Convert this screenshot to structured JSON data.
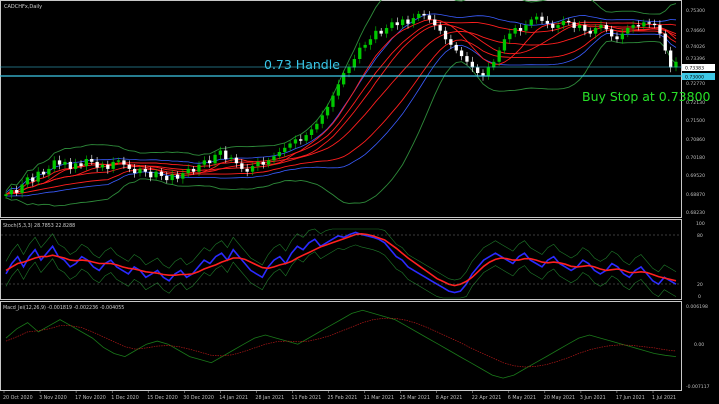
{
  "symbol_label": "CADCHFx,Daily",
  "colors": {
    "background": "#000000",
    "panel_border": "#c8c8c8",
    "bull_candle": "#00c800",
    "bear_candle": "#ffffff",
    "ma_lines": "#ff1e1e",
    "bb_outer": "#2e8b3a",
    "bb_mid": "#3a5cff",
    "handle_line": "#3ec8e6",
    "stoch_main": "#2a2aff",
    "stoch_signal": "#ff2020",
    "stoch_range": "#1f7a2a",
    "macd_main": "#1a7a1a",
    "macd_signal": "#b01818",
    "axis_text": "#bfbfbf",
    "annotation_handle": "#39c6e8",
    "annotation_buy": "#28e028"
  },
  "main_panel": {
    "price_ticks": [
      "0.75300",
      "0.74660",
      "0.74026",
      "0.73396",
      "0.72770",
      "0.72130",
      "0.71500",
      "0.70860",
      "0.70180",
      "0.69520",
      "0.68870",
      "0.68230"
    ],
    "price_tag_1": "0.73383",
    "price_tag_2": "0.73000",
    "annotation_handle": "0.73 Handle",
    "annotation_buy": "Buy Stop at 0.73800"
  },
  "stoch_panel": {
    "label": "Stoch(5,3,3) 28.7853 22.8288",
    "ticks": [
      "100",
      "80",
      "20",
      "0"
    ]
  },
  "macd_panel": {
    "label": "Macd_Jei(12,26,9) -0.001819 -0.002236 -0.004055",
    "ticks": [
      "0.006198",
      "0.00",
      "-0.007117"
    ]
  },
  "date_labels": [
    "20 Oct 2020",
    "3 Nov 2020",
    "17 Nov 2020",
    "1 Dec 2020",
    "15 Dec 2020",
    "30 Dec 2020",
    "14 Jan 2021",
    "28 Jan 2021",
    "11 Feb 2021",
    "25 Feb 2021",
    "11 Mar 2021",
    "25 Mar 2021",
    "8 Apr 2021",
    "22 Apr 2021",
    "6 May 2021",
    "20 May 2021",
    "3 Jun 2021",
    "17 Jun 2021",
    "1 Jul 2021"
  ],
  "chart_data": {
    "type": "candlestick",
    "symbol": "CADCHFx",
    "timeframe": "Daily",
    "closes": [
      0.687,
      0.6885,
      0.6875,
      0.6905,
      0.693,
      0.6915,
      0.695,
      0.694,
      0.696,
      0.699,
      0.6975,
      0.6985,
      0.696,
      0.698,
      0.697,
      0.6995,
      0.6985,
      0.6965,
      0.6975,
      0.696,
      0.6985,
      0.699,
      0.6975,
      0.696,
      0.6945,
      0.696,
      0.695,
      0.693,
      0.695,
      0.6935,
      0.692,
      0.694,
      0.6925,
      0.6945,
      0.696,
      0.695,
      0.6975,
      0.699,
      0.698,
      0.701,
      0.7025,
      0.6995,
      0.7,
      0.698,
      0.696,
      0.695,
      0.697,
      0.6985,
      0.6975,
      0.699,
      0.7005,
      0.702,
      0.7035,
      0.705,
      0.7065,
      0.706,
      0.708,
      0.71,
      0.712,
      0.715,
      0.718,
      0.722,
      0.726,
      0.73,
      0.732,
      0.735,
      0.739,
      0.74,
      0.742,
      0.745,
      0.744,
      0.746,
      0.748,
      0.747,
      0.749,
      0.7475,
      0.7495,
      0.751,
      0.7505,
      0.749,
      0.747,
      0.745,
      0.742,
      0.74,
      0.738,
      0.736,
      0.734,
      0.732,
      0.73,
      0.729,
      0.732,
      0.734,
      0.738,
      0.742,
      0.744,
      0.746,
      0.745,
      0.747,
      0.749,
      0.75,
      0.7485,
      0.7475,
      0.746,
      0.747,
      0.7485,
      0.748,
      0.746,
      0.747,
      0.745,
      0.744,
      0.746,
      0.747,
      0.7455,
      0.743,
      0.742,
      0.744,
      0.746,
      0.747,
      0.7465,
      0.748,
      0.7475,
      0.747,
      0.744,
      0.738,
      0.732,
      0.734
    ],
    "levels": [
      {
        "name": "0.73 Handle",
        "price": 0.73
      },
      {
        "name": "Buy Stop",
        "price": 0.738
      }
    ],
    "stoch_k": [
      35,
      50,
      60,
      45,
      60,
      70,
      55,
      65,
      75,
      60,
      55,
      45,
      50,
      60,
      55,
      45,
      40,
      50,
      55,
      45,
      40,
      35,
      45,
      40,
      30,
      35,
      40,
      30,
      25,
      35,
      40,
      30,
      35,
      45,
      55,
      50,
      60,
      65,
      55,
      70,
      60,
      50,
      40,
      35,
      30,
      45,
      55,
      60,
      50,
      65,
      75,
      70,
      80,
      85,
      75,
      80,
      85,
      90,
      88,
      92,
      95,
      92,
      90,
      88,
      85,
      80,
      70,
      60,
      55,
      45,
      40,
      35,
      30,
      25,
      20,
      15,
      10,
      8,
      10,
      20,
      35,
      45,
      55,
      60,
      65,
      60,
      55,
      50,
      60,
      65,
      55,
      50,
      45,
      55,
      60,
      50,
      45,
      40,
      45,
      55,
      50,
      40,
      35,
      40,
      50,
      45,
      35,
      30,
      40,
      45,
      35,
      25,
      20,
      30,
      25,
      20
    ],
    "stoch_d": [
      40,
      45,
      50,
      52,
      55,
      58,
      60,
      60,
      62,
      60,
      58,
      55,
      54,
      55,
      54,
      52,
      50,
      50,
      50,
      48,
      45,
      43,
      42,
      40,
      38,
      37,
      36,
      34,
      33,
      33,
      34,
      34,
      35,
      38,
      42,
      45,
      48,
      52,
      55,
      58,
      58,
      56,
      52,
      48,
      44,
      43,
      45,
      48,
      50,
      53,
      58,
      62,
      66,
      70,
      74,
      77,
      80,
      83,
      86,
      89,
      92,
      93,
      92,
      90,
      87,
      84,
      78,
      72,
      65,
      58,
      52,
      46,
      40,
      34,
      28,
      24,
      20,
      18,
      20,
      24,
      30,
      38,
      46,
      52,
      56,
      58,
      57,
      55,
      55,
      57,
      57,
      55,
      52,
      51,
      52,
      51,
      49,
      46,
      45,
      46,
      47,
      45,
      42,
      40,
      41,
      42,
      40,
      37,
      37,
      38,
      37,
      34,
      31,
      29,
      27,
      25
    ],
    "macd_main": [
      0.001,
      0.0025,
      0.0035,
      0.002,
      0.003,
      0.004,
      0.003,
      0.002,
      0.001,
      -0.0005,
      -0.0015,
      -0.002,
      -0.001,
      0.0,
      0.0005,
      0.0,
      -0.001,
      -0.002,
      -0.0025,
      -0.003,
      -0.002,
      -0.001,
      0.0,
      0.001,
      0.0015,
      0.001,
      0.0005,
      0.0,
      0.001,
      0.002,
      0.003,
      0.004,
      0.005,
      0.0055,
      0.005,
      0.0045,
      0.004,
      0.003,
      0.002,
      0.001,
      0.0,
      -0.001,
      -0.002,
      -0.003,
      -0.004,
      -0.005,
      -0.0055,
      -0.005,
      -0.004,
      -0.003,
      -0.002,
      -0.001,
      0.0,
      0.001,
      0.0015,
      0.001,
      0.0005,
      0.0,
      -0.0005,
      -0.001,
      -0.0015,
      -0.0018,
      -0.002
    ],
    "macd_signal": [
      0.0005,
      0.0012,
      0.002,
      0.0022,
      0.0025,
      0.003,
      0.003,
      0.0027,
      0.002,
      0.0012,
      0.0004,
      -0.0004,
      -0.0008,
      -0.0006,
      -0.0003,
      -0.0002,
      -0.0004,
      -0.0008,
      -0.0013,
      -0.0018,
      -0.0019,
      -0.0017,
      -0.0012,
      -0.0006,
      0.0,
      0.0004,
      0.0005,
      0.0004,
      0.0005,
      0.0009,
      0.0014,
      0.0021,
      0.0028,
      0.0035,
      0.004,
      0.0042,
      0.0042,
      0.0039,
      0.0034,
      0.0027,
      0.0019,
      0.0011,
      0.0003,
      -0.0006,
      -0.0014,
      -0.0022,
      -0.003,
      -0.0035,
      -0.0037,
      -0.0036,
      -0.0033,
      -0.0028,
      -0.0022,
      -0.0015,
      -0.0009,
      -0.0005,
      -0.0002,
      -0.0001,
      -0.0002,
      -0.0004,
      -0.0006,
      -0.0009,
      -0.0011
    ]
  }
}
